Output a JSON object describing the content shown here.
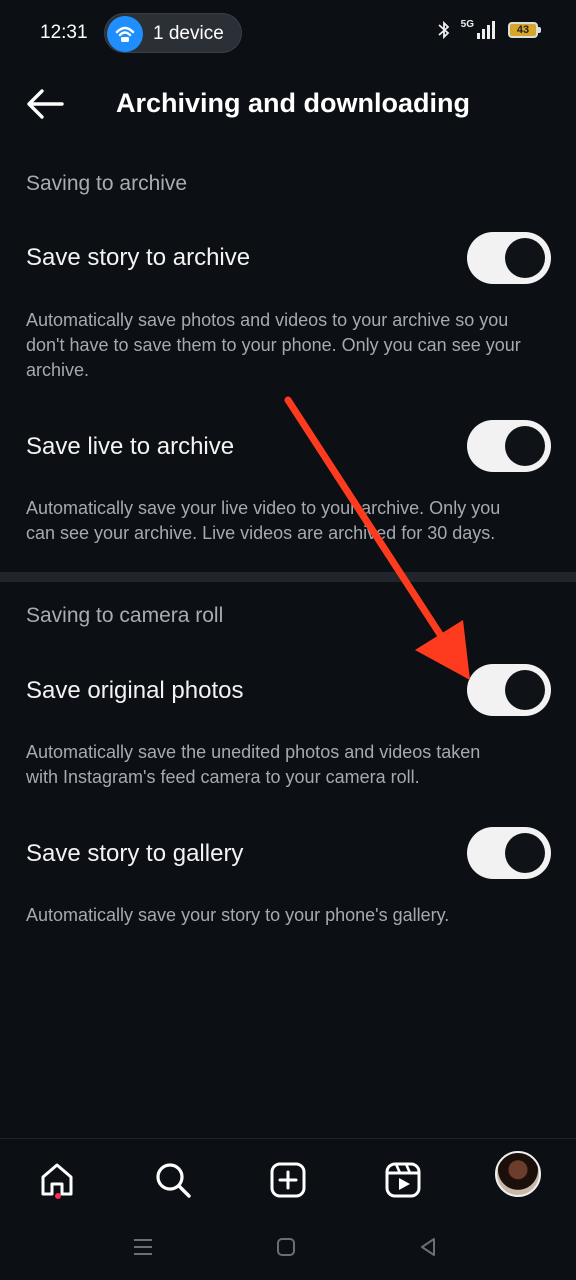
{
  "status_bar": {
    "time": "12:31",
    "device_pill": "1 device",
    "network": "5G",
    "battery": "43"
  },
  "header": {
    "title": "Archiving and downloading"
  },
  "sections": {
    "archive": {
      "label": "Saving to archive",
      "rows": [
        {
          "label": "Save story to archive",
          "description_lines": [
            "Automatically save photos and videos to your archive so you",
            "don't have to save them to your phone. Only you can see your",
            "archive."
          ],
          "enabled": true
        },
        {
          "label": "Save live to archive",
          "description_lines": [
            "Automatically save your live video to your archive. Only you",
            "can see your archive. Live videos are archived for 30 days."
          ],
          "enabled": true
        }
      ]
    },
    "camera_roll": {
      "label": "Saving to camera roll",
      "rows": [
        {
          "label": "Save original photos",
          "description_lines": [
            "Automatically save the unedited photos and videos taken",
            "with Instagram's feed camera to your camera roll."
          ],
          "enabled": true
        },
        {
          "label": "Save story to gallery",
          "description_lines": [
            "Automatically save your story to your phone's gallery."
          ],
          "enabled": true
        }
      ]
    }
  },
  "bottom_nav": {
    "items": [
      "home-icon",
      "search-icon",
      "create-icon",
      "reels-icon",
      "profile-avatar"
    ],
    "active": "home-icon"
  },
  "colors": {
    "background": "#0c0f14",
    "toggle_on": "#f2f2f2",
    "accent_arrow": "#ff3b1f",
    "notification_dot": "#ff2d55"
  }
}
